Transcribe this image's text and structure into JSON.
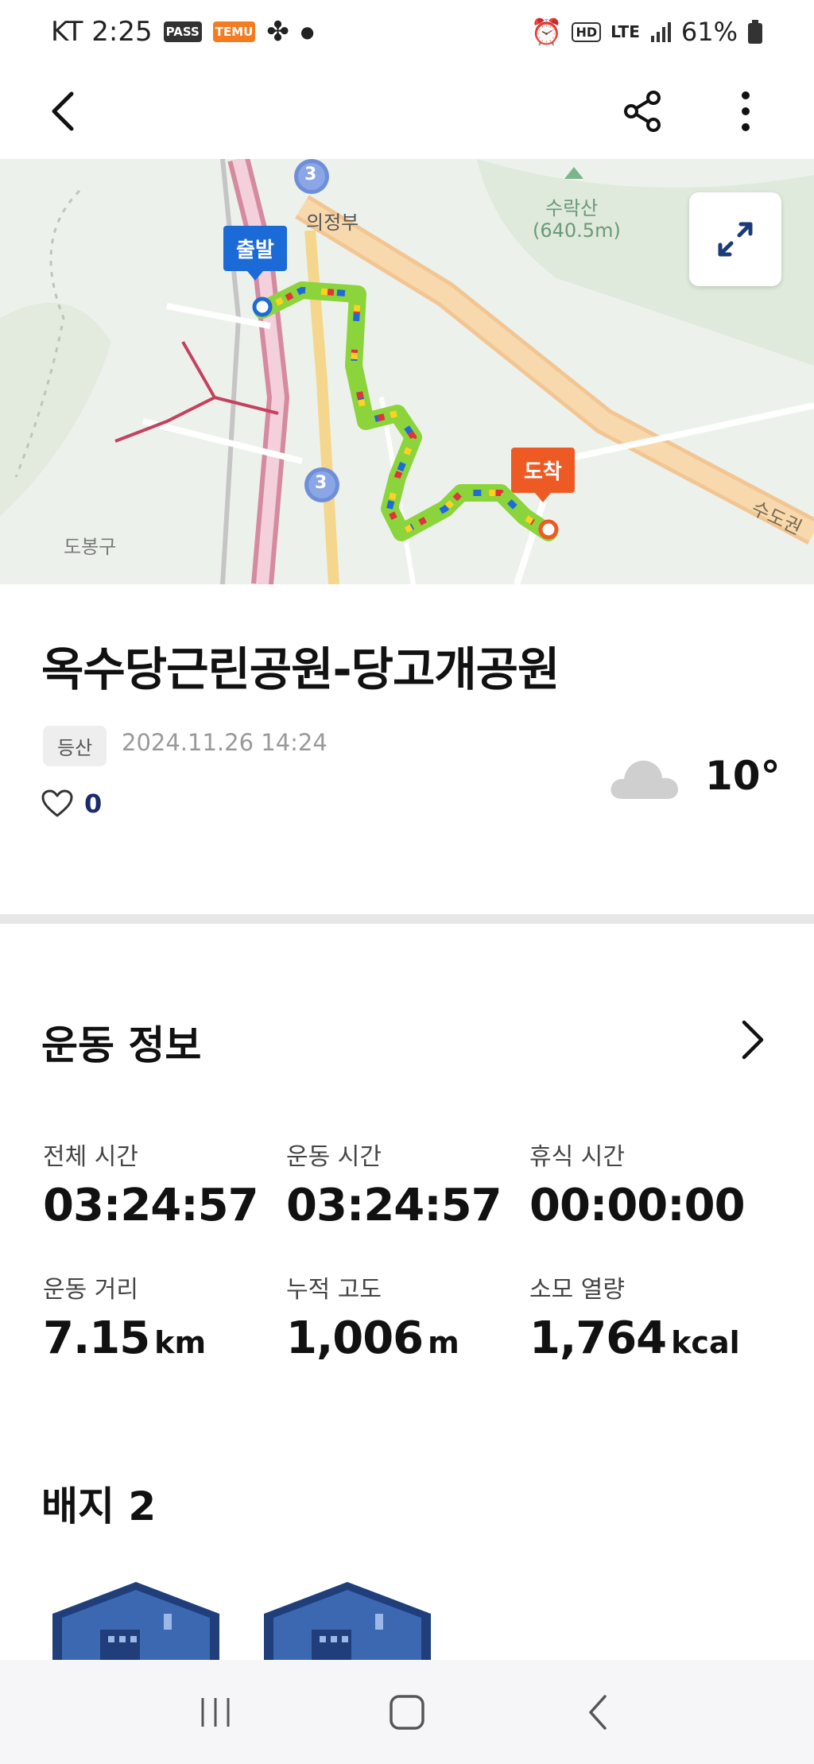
{
  "status_bar": {
    "carrier_time": "KT 2:25",
    "badges": [
      "PASS",
      "TEMU"
    ],
    "network": "LTE",
    "battery": "61%"
  },
  "header": {
    "icons": [
      "back-icon",
      "share-icon",
      "more-vertical-icon"
    ]
  },
  "map": {
    "start_label": "출발",
    "end_label": "도착",
    "places": {
      "city": "의정부",
      "mountain": "수락산",
      "mountain_elevation": "(640.5m)",
      "district": "도봉구",
      "road": "수도권",
      "route_number": "3"
    }
  },
  "activity": {
    "title": "옥수당근린공원-당고개공원",
    "category": "등산",
    "datetime": "2024.11.26 14:24",
    "likes": "0",
    "weather_icon": "cloud-icon",
    "temperature": "10°"
  },
  "exercise_info": {
    "title": "운동 정보",
    "stats": [
      {
        "label": "전체 시간",
        "value": "03:24:57",
        "unit": ""
      },
      {
        "label": "운동 시간",
        "value": "03:24:57",
        "unit": ""
      },
      {
        "label": "휴식 시간",
        "value": "00:00:00",
        "unit": ""
      },
      {
        "label": "운동 거리",
        "value": "7.15",
        "unit": "km"
      },
      {
        "label": "누적 고도",
        "value": "1,006",
        "unit": "m"
      },
      {
        "label": "소모 열량",
        "value": "1,764",
        "unit": "kcal"
      }
    ]
  },
  "badges": {
    "title": "배지 2"
  },
  "colors": {
    "accent_blue": "#1a6bd8",
    "accent_orange": "#ee5a24",
    "route_green": "#8cd43c"
  }
}
